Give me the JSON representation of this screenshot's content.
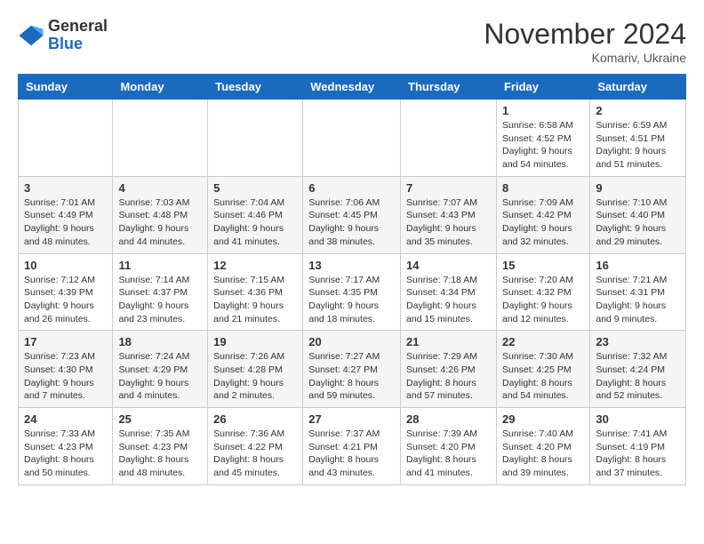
{
  "logo": {
    "general": "General",
    "blue": "Blue"
  },
  "title": "November 2024",
  "location": "Komariv, Ukraine",
  "weekdays": [
    "Sunday",
    "Monday",
    "Tuesday",
    "Wednesday",
    "Thursday",
    "Friday",
    "Saturday"
  ],
  "weeks": [
    [
      null,
      null,
      null,
      null,
      null,
      {
        "day": "1",
        "sunrise": "6:58 AM",
        "sunset": "4:52 PM",
        "daylight": "9 hours and 54 minutes."
      },
      {
        "day": "2",
        "sunrise": "6:59 AM",
        "sunset": "4:51 PM",
        "daylight": "9 hours and 51 minutes."
      }
    ],
    [
      {
        "day": "3",
        "sunrise": "7:01 AM",
        "sunset": "4:49 PM",
        "daylight": "9 hours and 48 minutes."
      },
      {
        "day": "4",
        "sunrise": "7:03 AM",
        "sunset": "4:48 PM",
        "daylight": "9 hours and 44 minutes."
      },
      {
        "day": "5",
        "sunrise": "7:04 AM",
        "sunset": "4:46 PM",
        "daylight": "9 hours and 41 minutes."
      },
      {
        "day": "6",
        "sunrise": "7:06 AM",
        "sunset": "4:45 PM",
        "daylight": "9 hours and 38 minutes."
      },
      {
        "day": "7",
        "sunrise": "7:07 AM",
        "sunset": "4:43 PM",
        "daylight": "9 hours and 35 minutes."
      },
      {
        "day": "8",
        "sunrise": "7:09 AM",
        "sunset": "4:42 PM",
        "daylight": "9 hours and 32 minutes."
      },
      {
        "day": "9",
        "sunrise": "7:10 AM",
        "sunset": "4:40 PM",
        "daylight": "9 hours and 29 minutes."
      }
    ],
    [
      {
        "day": "10",
        "sunrise": "7:12 AM",
        "sunset": "4:39 PM",
        "daylight": "9 hours and 26 minutes."
      },
      {
        "day": "11",
        "sunrise": "7:14 AM",
        "sunset": "4:37 PM",
        "daylight": "9 hours and 23 minutes."
      },
      {
        "day": "12",
        "sunrise": "7:15 AM",
        "sunset": "4:36 PM",
        "daylight": "9 hours and 21 minutes."
      },
      {
        "day": "13",
        "sunrise": "7:17 AM",
        "sunset": "4:35 PM",
        "daylight": "9 hours and 18 minutes."
      },
      {
        "day": "14",
        "sunrise": "7:18 AM",
        "sunset": "4:34 PM",
        "daylight": "9 hours and 15 minutes."
      },
      {
        "day": "15",
        "sunrise": "7:20 AM",
        "sunset": "4:32 PM",
        "daylight": "9 hours and 12 minutes."
      },
      {
        "day": "16",
        "sunrise": "7:21 AM",
        "sunset": "4:31 PM",
        "daylight": "9 hours and 9 minutes."
      }
    ],
    [
      {
        "day": "17",
        "sunrise": "7:23 AM",
        "sunset": "4:30 PM",
        "daylight": "9 hours and 7 minutes."
      },
      {
        "day": "18",
        "sunrise": "7:24 AM",
        "sunset": "4:29 PM",
        "daylight": "9 hours and 4 minutes."
      },
      {
        "day": "19",
        "sunrise": "7:26 AM",
        "sunset": "4:28 PM",
        "daylight": "9 hours and 2 minutes."
      },
      {
        "day": "20",
        "sunrise": "7:27 AM",
        "sunset": "4:27 PM",
        "daylight": "8 hours and 59 minutes."
      },
      {
        "day": "21",
        "sunrise": "7:29 AM",
        "sunset": "4:26 PM",
        "daylight": "8 hours and 57 minutes."
      },
      {
        "day": "22",
        "sunrise": "7:30 AM",
        "sunset": "4:25 PM",
        "daylight": "8 hours and 54 minutes."
      },
      {
        "day": "23",
        "sunrise": "7:32 AM",
        "sunset": "4:24 PM",
        "daylight": "8 hours and 52 minutes."
      }
    ],
    [
      {
        "day": "24",
        "sunrise": "7:33 AM",
        "sunset": "4:23 PM",
        "daylight": "8 hours and 50 minutes."
      },
      {
        "day": "25",
        "sunrise": "7:35 AM",
        "sunset": "4:23 PM",
        "daylight": "8 hours and 48 minutes."
      },
      {
        "day": "26",
        "sunrise": "7:36 AM",
        "sunset": "4:22 PM",
        "daylight": "8 hours and 45 minutes."
      },
      {
        "day": "27",
        "sunrise": "7:37 AM",
        "sunset": "4:21 PM",
        "daylight": "8 hours and 43 minutes."
      },
      {
        "day": "28",
        "sunrise": "7:39 AM",
        "sunset": "4:20 PM",
        "daylight": "8 hours and 41 minutes."
      },
      {
        "day": "29",
        "sunrise": "7:40 AM",
        "sunset": "4:20 PM",
        "daylight": "8 hours and 39 minutes."
      },
      {
        "day": "30",
        "sunrise": "7:41 AM",
        "sunset": "4:19 PM",
        "daylight": "8 hours and 37 minutes."
      }
    ]
  ],
  "labels": {
    "sunrise": "Sunrise:",
    "sunset": "Sunset:",
    "daylight": "Daylight:"
  }
}
